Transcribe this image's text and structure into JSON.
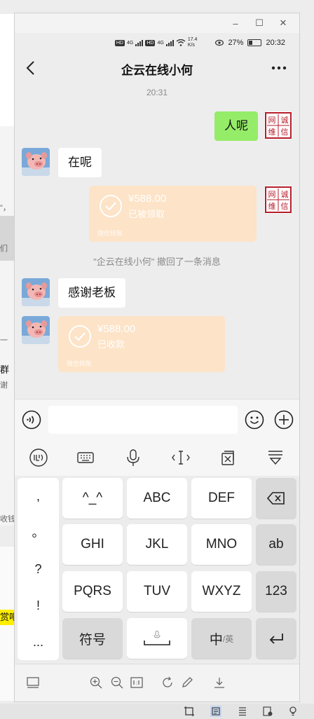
{
  "window": {
    "controls": [
      "–",
      "☐",
      "✕"
    ]
  },
  "status_bar": {
    "net_tags": [
      "HD",
      "HD"
    ],
    "net_labels": [
      "4G",
      "4G"
    ],
    "speed": "17.4",
    "speed_unit": "K/s",
    "battery": "27%",
    "time": "20:32"
  },
  "chat": {
    "title": "企云在线小何",
    "timestamp": "20:31",
    "messages": {
      "m1": "人呢",
      "m2": "在呢",
      "m3_amount": "¥588.00",
      "m3_status": "已被领取",
      "m3_footer": "微信转账",
      "recall_notice": "\"企云在线小何\" 撤回了一条消息",
      "m4": "感谢老板",
      "m5_amount": "¥588.00",
      "m5_status": "已收款",
      "m5_footer": "微信转账"
    },
    "stamp_text": [
      "网",
      "诚",
      "维",
      "信"
    ]
  },
  "keyboard": {
    "punctuation": [
      ",",
      "。",
      "?",
      "!",
      "..."
    ],
    "keys": {
      "k_emo": "^_^",
      "k_abc": "ABC",
      "k_def": "DEF",
      "k_ghi": "GHI",
      "k_jkl": "JKL",
      "k_mno": "MNO",
      "k_ab": "ab",
      "k_pqrs": "PQRS",
      "k_tuv": "TUV",
      "k_wxyz": "WXYZ",
      "k_123": "123",
      "k_symbols": "符号",
      "k_zh": "中",
      "k_en": "/英"
    }
  },
  "background": {
    "fragments": [
      "\"，",
      "们",
      "一",
      "群",
      "谢",
      "收钱",
      "赏吧"
    ]
  },
  "colors": {
    "my_bubble": "#95ec69",
    "transfer_card": "#fde3c7",
    "chat_bg": "#ededed"
  }
}
